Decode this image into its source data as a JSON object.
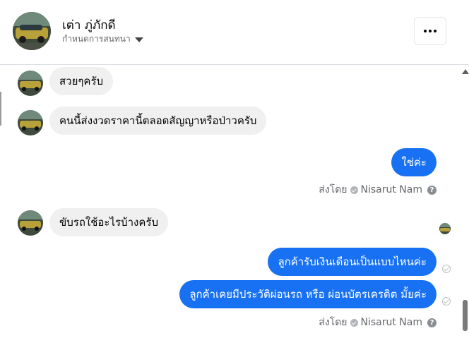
{
  "header": {
    "name": "เต่า ภู่ภักดี",
    "subtitle": "กำหนดการสนทนา",
    "avatar_icon": "car-photo-avatar",
    "more_icon": "more-options-icon"
  },
  "messages": [
    {
      "side": "in",
      "text": "สวยๆครับ"
    },
    {
      "side": "in",
      "text": "คนนี้ส่งงวดราคานี้ตลอดสัญญาหรือป่าวครับ"
    },
    {
      "side": "out",
      "text": "ใช่ค่ะ"
    },
    {
      "side": "in",
      "text": "ขับรถใช้อะไรบ้างครับ"
    },
    {
      "side": "out",
      "text": "ลูกค้ารับเงินเดือนเป็นแบบไหนค่ะ"
    },
    {
      "side": "out",
      "text": "ลูกค้าเคยมีประวัติผ่อนรถ หรือ ผ่อนบัตรเครดิต มั้ยค่ะ"
    }
  ],
  "sent_by": {
    "prefix": "ส่งโดย",
    "sender": "Nisarut Nam",
    "help_glyph": "?"
  },
  "colors": {
    "outgoing_bubble": "#1771f2",
    "incoming_bubble": "#f0f0f0"
  }
}
